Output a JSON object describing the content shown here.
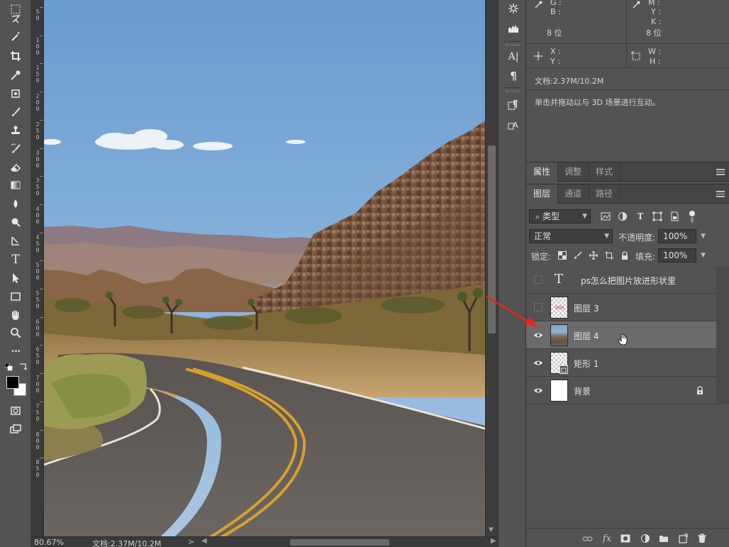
{
  "toolbar": {
    "tools": [
      {
        "name": "marquee-tool-icon"
      },
      {
        "name": "lasso-tool-icon"
      },
      {
        "name": "magic-wand-tool-icon"
      },
      {
        "name": "crop-tool-icon"
      },
      {
        "name": "eyedropper-tool-icon"
      },
      {
        "name": "frame-tool-icon"
      },
      {
        "name": "brush-tool-icon"
      },
      {
        "name": "clone-stamp-tool-icon"
      },
      {
        "name": "history-brush-tool-icon"
      },
      {
        "name": "eraser-tool-icon"
      },
      {
        "name": "gradient-tool-icon"
      },
      {
        "name": "blur-tool-icon"
      },
      {
        "name": "dodge-tool-icon"
      },
      {
        "name": "pen-tool-icon"
      },
      {
        "name": "type-tool-icon"
      },
      {
        "name": "path-selection-tool-icon"
      },
      {
        "name": "rectangle-tool-icon"
      },
      {
        "name": "hand-tool-icon"
      },
      {
        "name": "zoom-tool-icon"
      },
      {
        "name": "more-tools-icon"
      }
    ],
    "type_tool_glyph": "T",
    "more_glyph": "•••"
  },
  "ruler": {
    "labels": [
      "5 0",
      "1 0 0",
      "1 5 0",
      "2 0 0",
      "2 5 0",
      "3 0 0",
      "3 5 0",
      "4 0 0",
      "4 5 0",
      "5 0 0",
      "5 5 0",
      "6 0 0",
      "6 5 0",
      "7 0 0",
      "7 5 0",
      "8 0 0",
      "8 5 0"
    ]
  },
  "status": {
    "zoom": "80.67%",
    "doc": "文档:2.37M/10.2M",
    "arrow": ">"
  },
  "info": {
    "g_label": "G :",
    "b_label": "B :",
    "m_label": "M :",
    "y_label": "Y :",
    "k_label": "K :",
    "bit_left": "8 位",
    "bit_right": "8 位",
    "x_label": "X :",
    "y2_label": "Y :",
    "w_label": "W :",
    "h_label": "H :",
    "doc": "文档:2.37M/10.2M",
    "hint": "单击并拖动以与 3D 场景进行互动。"
  },
  "panel_tabs_top": [
    "属性",
    "调整",
    "样式"
  ],
  "panel_tabs_layers": [
    "图层",
    "通道",
    "路径"
  ],
  "layer_controls": {
    "filter_kind": "类型",
    "blend_mode": "正常",
    "opacity_label": "不透明度:",
    "opacity_value": "100%",
    "lock_label": "锁定:",
    "fill_label": "填充:",
    "fill_value": "100%"
  },
  "layers": [
    {
      "name": "ps怎么把图片放进形状里",
      "type": "text",
      "visible": false,
      "selected": false
    },
    {
      "name": "图层 3",
      "type": "pixel",
      "visible": false,
      "selected": false
    },
    {
      "name": "图层 4",
      "type": "photo",
      "visible": true,
      "selected": true
    },
    {
      "name": "矩形 1",
      "type": "shape",
      "visible": true,
      "selected": false
    },
    {
      "name": "背景",
      "type": "background",
      "visible": true,
      "selected": false,
      "locked": true
    }
  ],
  "mid_dock": {
    "char_glyph": "A|",
    "para_glyph": "¶"
  },
  "colors": {
    "panel_bg": "#535353",
    "dark_bg": "#3a3a3a",
    "selected_layer": "#6b6b6b",
    "annotation_arrow": "#e8251c"
  }
}
